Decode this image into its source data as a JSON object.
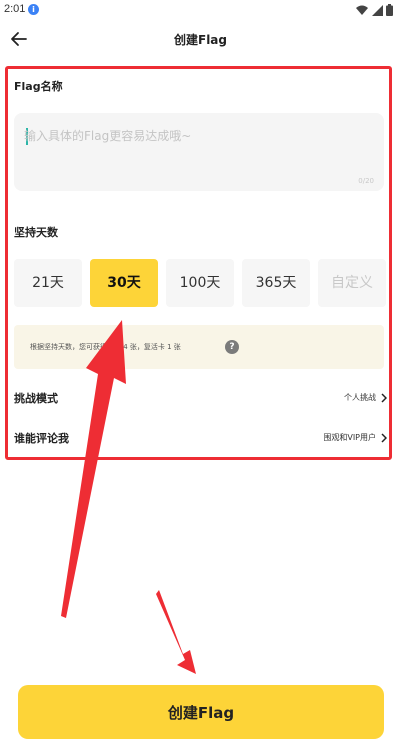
{
  "status_bar": {
    "time": "2:01",
    "badge": "i"
  },
  "header": {
    "title": "创建Flag"
  },
  "name_section": {
    "label": "Flag名称",
    "placeholder": "输入具体的Flag更容易达成哦~",
    "char_count": "0/20"
  },
  "days_section": {
    "label": "坚持天数",
    "options": [
      "21天",
      "30天",
      "100天",
      "365天",
      "自定义"
    ],
    "selected": "30天"
  },
  "hint": {
    "text": "根据坚持天数，您可获得任务 4 张，复活卡 1 张",
    "help_icon": "?"
  },
  "challenge_mode": {
    "label": "挑战模式",
    "value": "个人挑战"
  },
  "comment_permission": {
    "label": "谁能评论我",
    "value": "围观和VIP用户"
  },
  "create_button": {
    "label": "创建Flag"
  },
  "colors": {
    "accent": "#fdd438",
    "annotation": "#ee2d34",
    "hint_bg": "#f9f5e7"
  }
}
